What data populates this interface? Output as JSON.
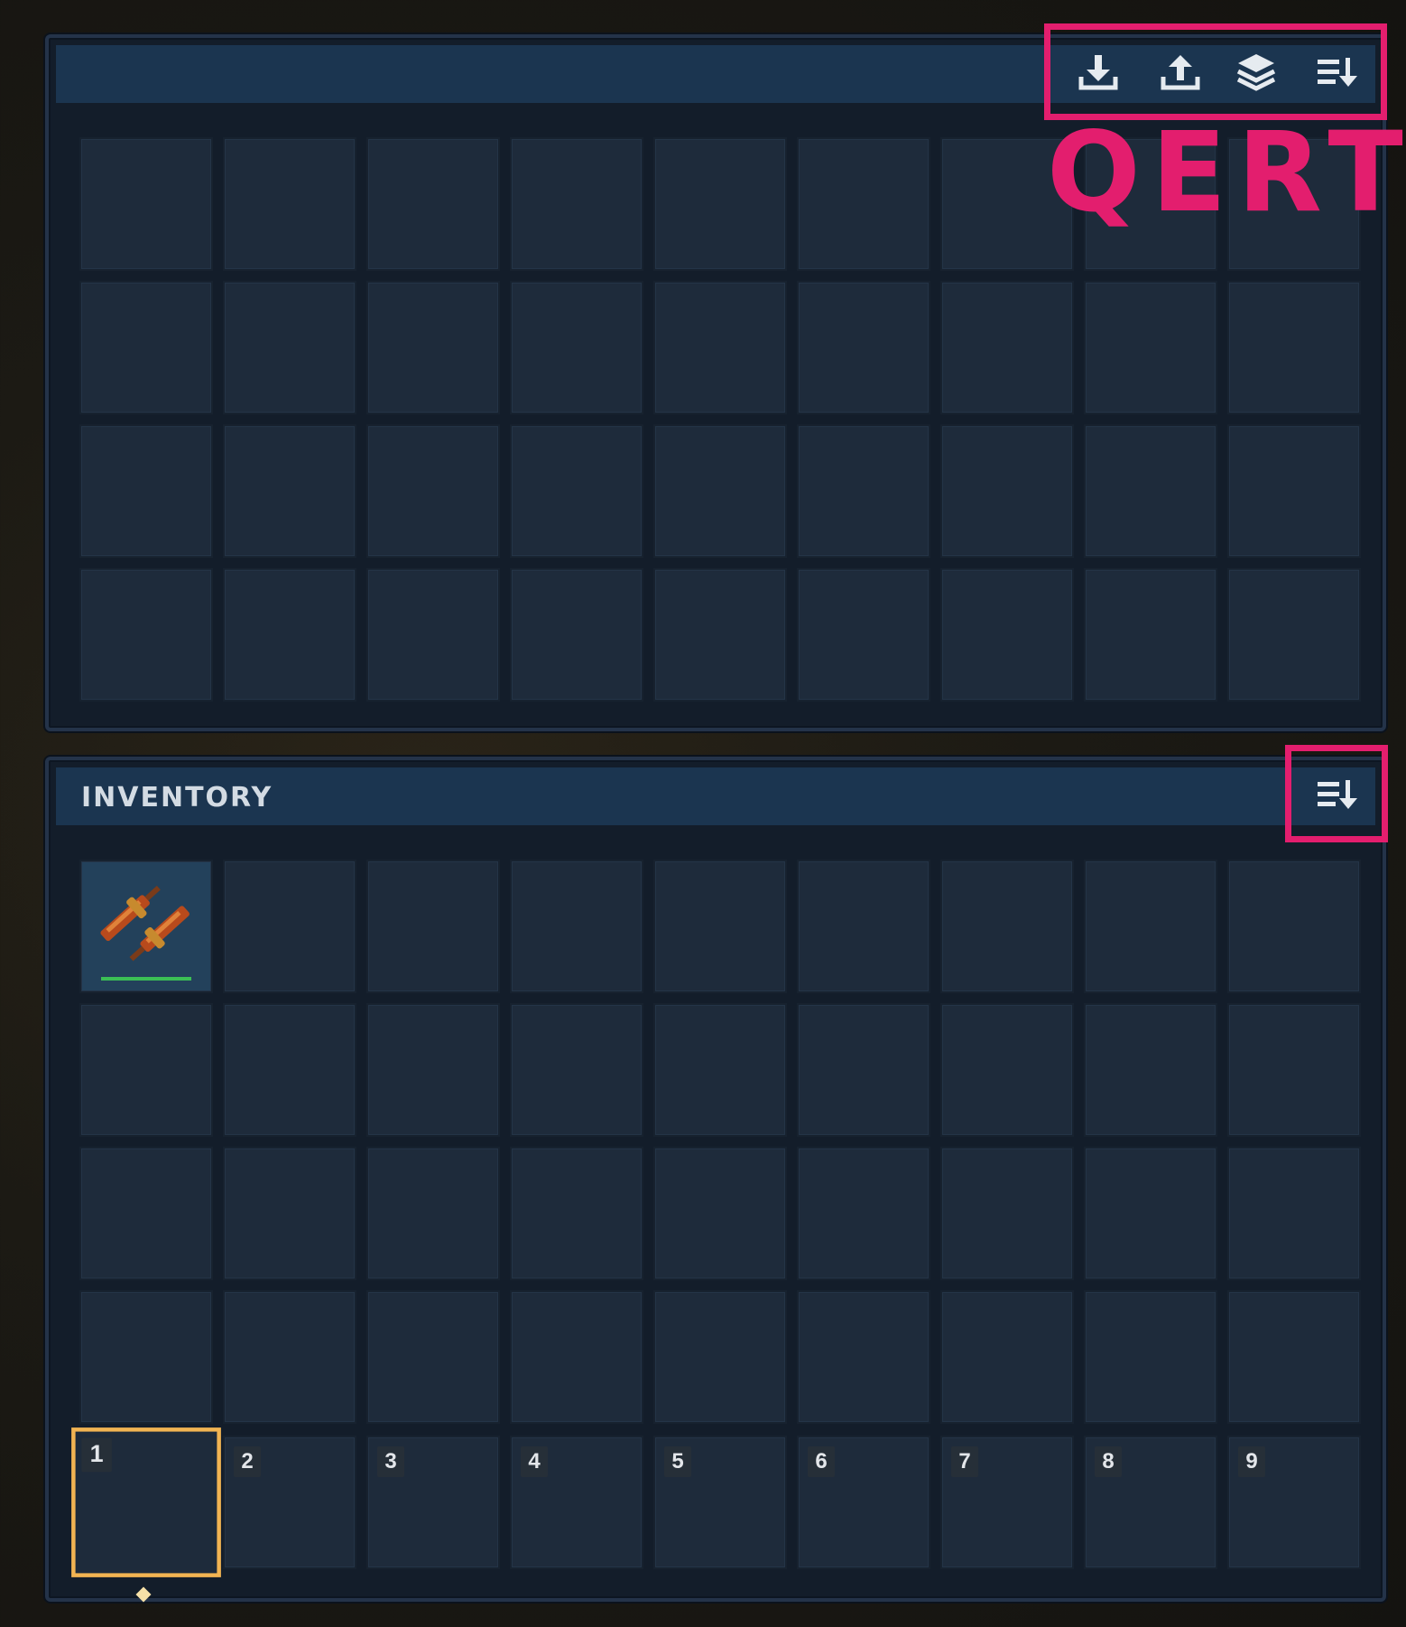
{
  "container": {
    "title": "",
    "toolbar": [
      {
        "name": "deposit-all-icon"
      },
      {
        "name": "take-all-icon"
      },
      {
        "name": "stack-icon"
      },
      {
        "name": "sort-icon"
      }
    ],
    "rows": 4,
    "cols": 9
  },
  "overlay": {
    "keys_label": "QERT",
    "highlight_color": "#e31e6e"
  },
  "inventory": {
    "title": "INVENTORY",
    "sort_icon": "sort-icon",
    "rows": 4,
    "cols": 9,
    "items": [
      {
        "slot": 0,
        "icon": "wooden-blades-item",
        "durability": 1.0
      }
    ],
    "hotbar": [
      "1",
      "2",
      "3",
      "4",
      "5",
      "6",
      "7",
      "8",
      "9"
    ],
    "selected_hotbar_index": 0
  },
  "colors": {
    "slot": "#1e2b3b",
    "header": "#1b3550",
    "selection": "#f2b452",
    "durability": "#3bbf55"
  }
}
